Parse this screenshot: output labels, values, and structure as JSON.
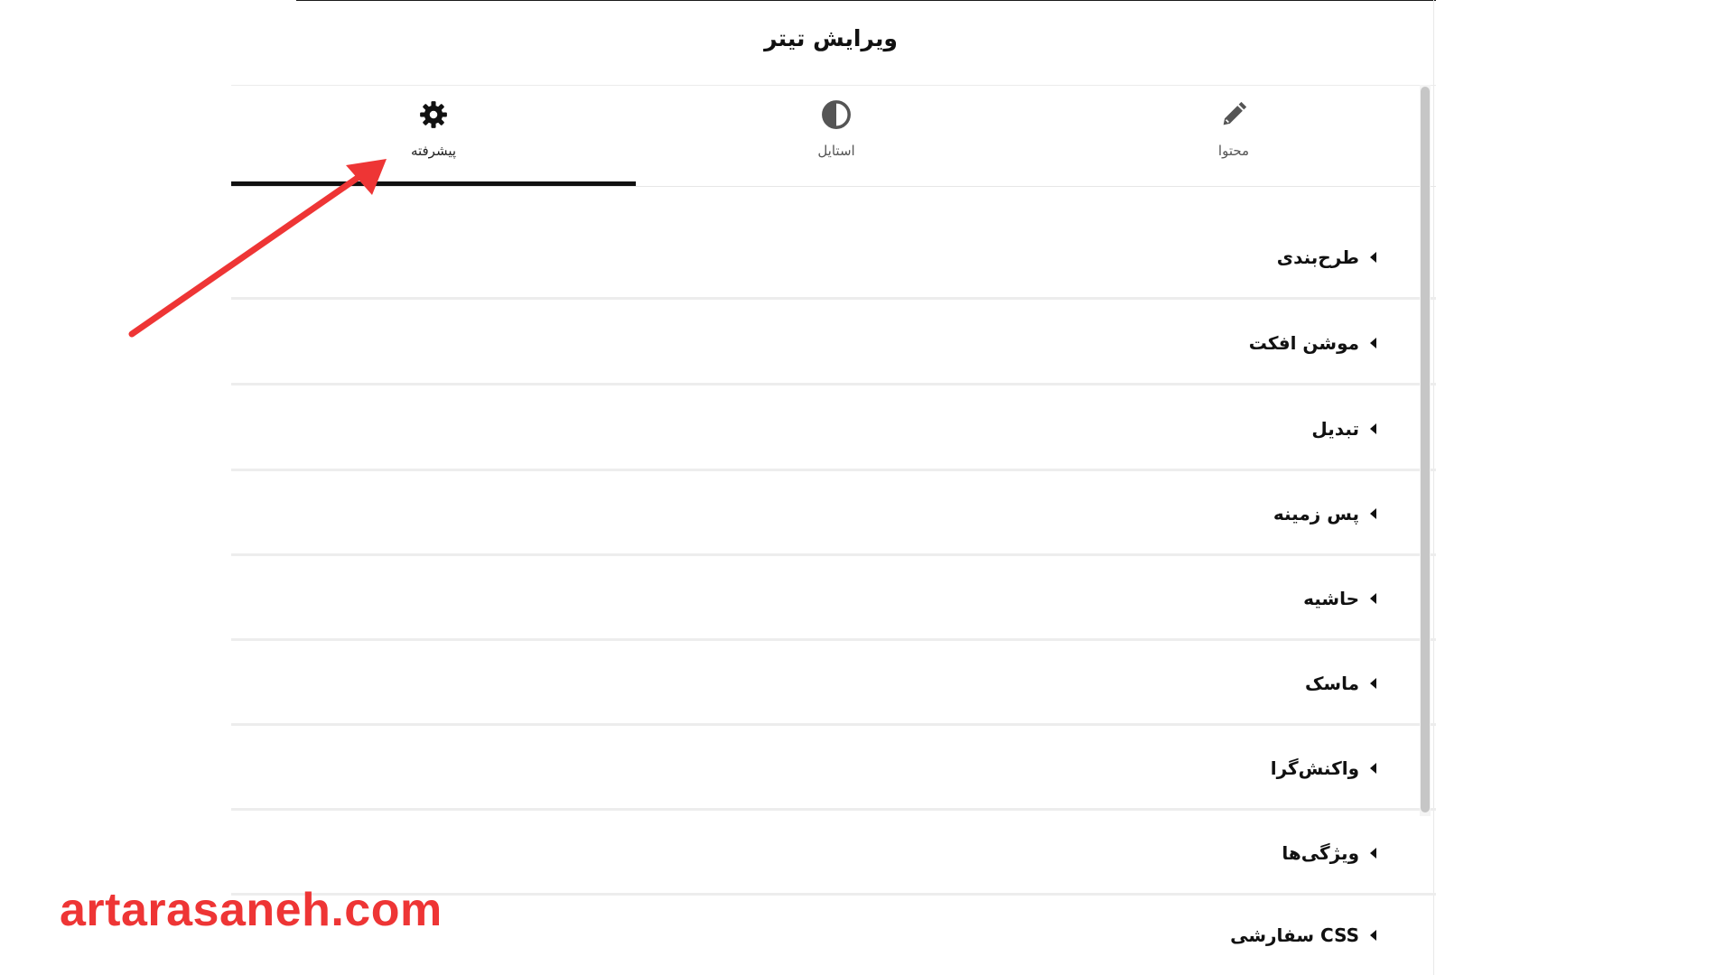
{
  "header": {
    "title": "ویرایش تیتر"
  },
  "tabs": [
    {
      "id": "content",
      "label": "محتوا",
      "icon": "pencil-icon",
      "active": false
    },
    {
      "id": "style",
      "label": "استایل",
      "icon": "half-circle-icon",
      "active": false
    },
    {
      "id": "advanced",
      "label": "پیشرفته",
      "icon": "gear-icon",
      "active": true
    }
  ],
  "sections": [
    {
      "label": "طرح‌بندی"
    },
    {
      "label": "موشن افکت"
    },
    {
      "label": "تبدیل"
    },
    {
      "label": "پس زمینه"
    },
    {
      "label": "حاشیه"
    },
    {
      "label": "ماسک"
    },
    {
      "label": "واکنش‌گرا"
    },
    {
      "label": "ویژگی‌ها"
    },
    {
      "label": "CSS سفارشی"
    }
  ],
  "annotation": {
    "arrow_color": "#ee3535"
  },
  "watermark": {
    "text": "artarasaneh.com",
    "color": "#ee3535"
  },
  "colors": {
    "active_tab_underline": "#111111",
    "scrollbar_thumb": "#c6c6c6"
  }
}
